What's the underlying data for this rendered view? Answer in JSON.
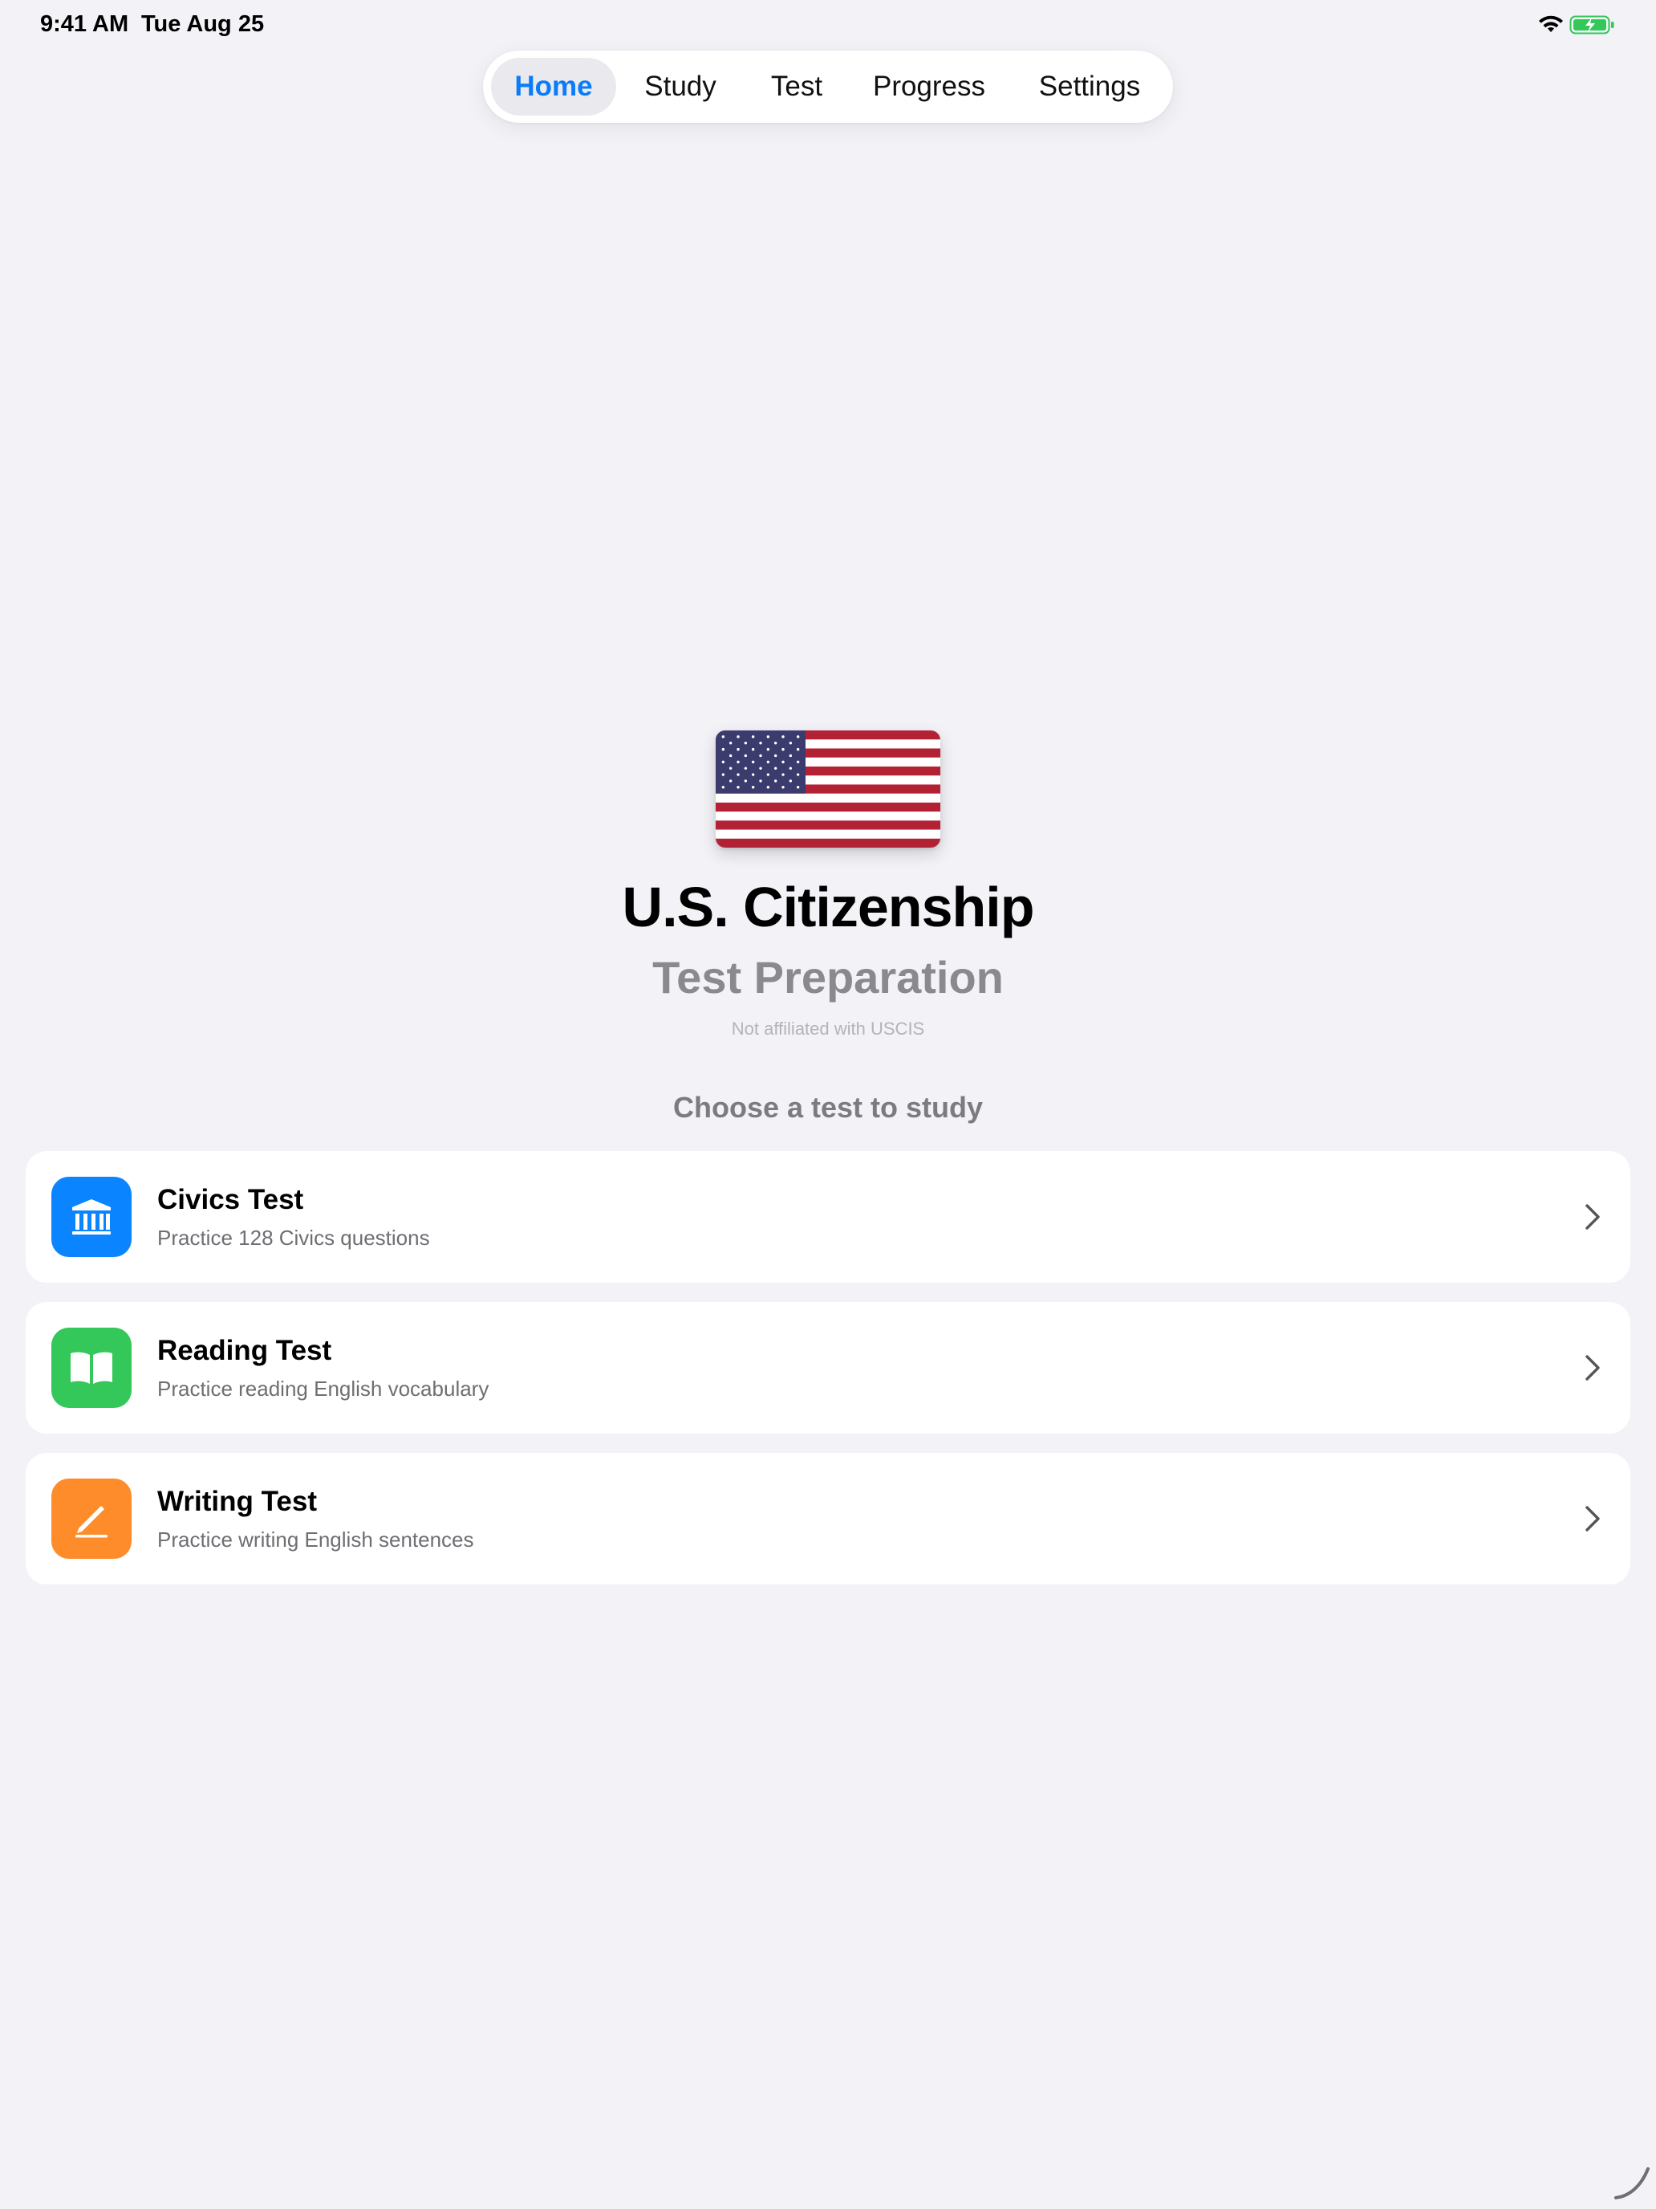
{
  "status_bar": {
    "time": "9:41 AM",
    "date": "Tue Aug 25",
    "wifi_icon": "wifi-icon",
    "battery_icon": "battery-charging-icon",
    "battery_color": "#34c759"
  },
  "tabs": [
    {
      "label": "Home",
      "active": true
    },
    {
      "label": "Study",
      "active": false
    },
    {
      "label": "Test",
      "active": false
    },
    {
      "label": "Progress",
      "active": false
    },
    {
      "label": "Settings",
      "active": false
    }
  ],
  "accent_color": "#0a7cf7",
  "hero": {
    "flag_icon": "us-flag-icon",
    "title": "U.S. Citizenship",
    "subtitle": "Test Preparation",
    "disclaimer": "Not affiliated with USCIS"
  },
  "section_heading": "Choose a test to study",
  "cards": [
    {
      "title": "Civics Test",
      "description": "Practice 128 Civics questions",
      "icon": "building-columns-icon",
      "icon_color": "#0a84ff"
    },
    {
      "title": "Reading Test",
      "description": "Practice reading English vocabulary",
      "icon": "book-icon",
      "icon_color": "#34c759"
    },
    {
      "title": "Writing Test",
      "description": "Practice writing English sentences",
      "icon": "pencil-icon",
      "icon_color": "#ff8c2a"
    }
  ]
}
